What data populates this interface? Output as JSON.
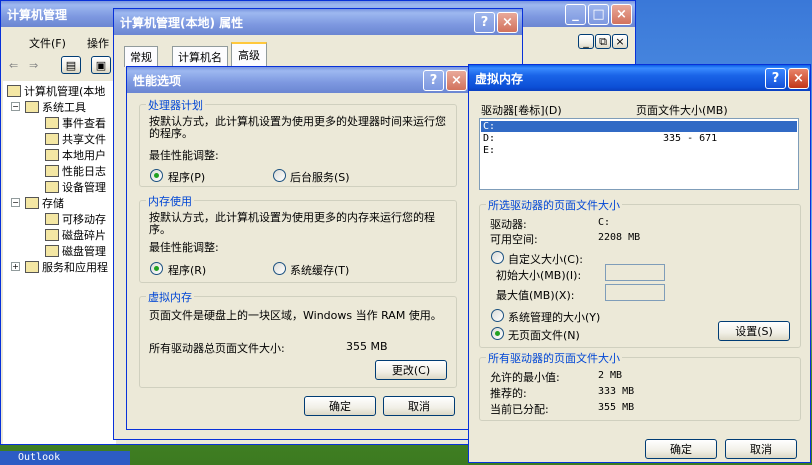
{
  "taskbar": {
    "item": "Outlook"
  },
  "mmc": {
    "title": "计算机管理",
    "menu": [
      "文件(F)",
      "操作"
    ],
    "tree": [
      "计算机管理(本地",
      "系统工具",
      "事件查看",
      "共享文件",
      "本地用户",
      "性能日志",
      "设备管理",
      "存储",
      "可移动存",
      "磁盘碎片",
      "磁盘管理",
      "服务和应用程"
    ],
    "inner_controls": [
      "_",
      "⧉",
      "×"
    ]
  },
  "props": {
    "title": "计算机管理(本地) 属性",
    "tabs": [
      "常规",
      "计算机名",
      "高级"
    ],
    "help": "?",
    "close": "×"
  },
  "perf": {
    "title": "性能选项",
    "help": "?",
    "close": "×",
    "cpu": {
      "title": "处理器计划",
      "desc": "按默认方式，此计算机设置为使用更多的处理器时间来运行您的程序。",
      "adjust": "最佳性能调整:",
      "opt1": "程序(P)",
      "opt2": "后台服务(S)"
    },
    "mem": {
      "title": "内存使用",
      "desc": "按默认方式，此计算机设置为使用更多的内存来运行您的程序。",
      "adjust": "最佳性能调整:",
      "opt1": "程序(R)",
      "opt2": "系统缓存(T)"
    },
    "vm": {
      "title": "虚拟内存",
      "desc": "页面文件是硬盘上的一块区域，Windows 当作 RAM 使用。",
      "total_label": "所有驱动器总页面文件大小:",
      "total_value": "355 MB",
      "change": "更改(C)"
    },
    "ok": "确定",
    "cancel": "取消"
  },
  "vmem": {
    "title": "虚拟内存",
    "help": "?",
    "close": "×",
    "col_drive": "驱动器[卷标](D)",
    "col_size": "页面文件大小(MB)",
    "drives": [
      {
        "drive": "C:",
        "size": ""
      },
      {
        "drive": "D:",
        "size": "335 - 671"
      },
      {
        "drive": "E:",
        "size": ""
      }
    ],
    "selected": {
      "title": "所选驱动器的页面文件大小",
      "drive_label": "驱动器:",
      "drive_value": "C:",
      "space_label": "可用空间:",
      "space_value": "2208 MB",
      "custom": "自定义大小(C):",
      "initial": "初始大小(MB)(I):",
      "max": "最大值(MB)(X):",
      "system": "系统管理的大小(Y)",
      "none": "无页面文件(N)",
      "set": "设置(S)"
    },
    "total": {
      "title": "所有驱动器的页面文件大小",
      "min_label": "允许的最小值:",
      "min_value": "2 MB",
      "rec_label": "推荐的:",
      "rec_value": "333 MB",
      "cur_label": "当前已分配:",
      "cur_value": "355 MB"
    },
    "ok": "确定",
    "cancel": "取消"
  }
}
